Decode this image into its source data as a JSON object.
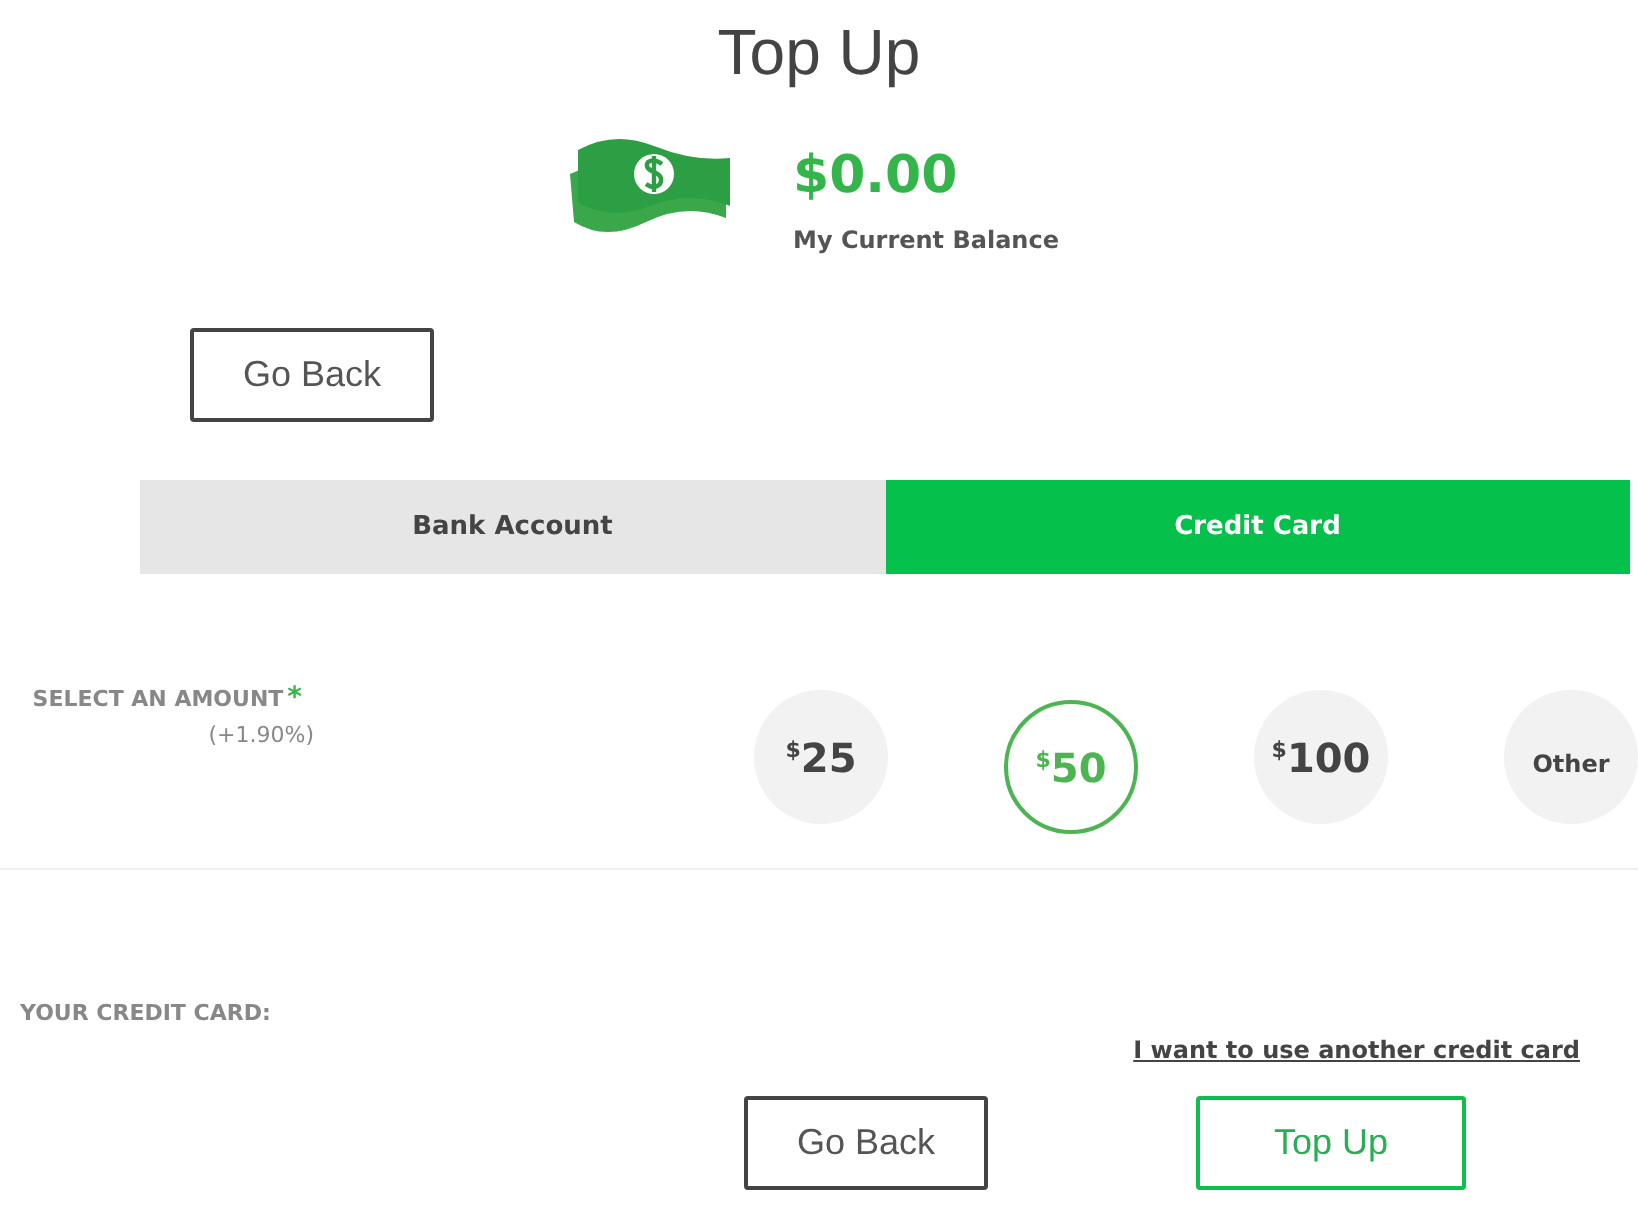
{
  "title": "Top Up",
  "balance": {
    "amount": "$0.00",
    "label": "My Current Balance"
  },
  "back_button": "Go Back",
  "tabs": [
    {
      "label": "Bank Account",
      "selected": false
    },
    {
      "label": "Credit Card",
      "selected": true
    }
  ],
  "amount_section": {
    "label": "SELECT AN AMOUNT",
    "required_mark": "*",
    "fee": "(+1.90%)",
    "options": [
      {
        "kind": "amount",
        "currency": "$",
        "value": "25",
        "selected": false
      },
      {
        "kind": "amount",
        "currency": "$",
        "value": "50",
        "selected": true
      },
      {
        "kind": "amount",
        "currency": "$",
        "value": "100",
        "selected": false
      },
      {
        "kind": "other",
        "label": "Other",
        "selected": false
      }
    ]
  },
  "card_section": {
    "label": "YOUR CREDIT CARD:",
    "link": "I want to use another credit card"
  },
  "buttons": [
    {
      "kind": "secondary",
      "label": "Go Back"
    },
    {
      "kind": "primary",
      "label": "Top Up"
    }
  ]
}
